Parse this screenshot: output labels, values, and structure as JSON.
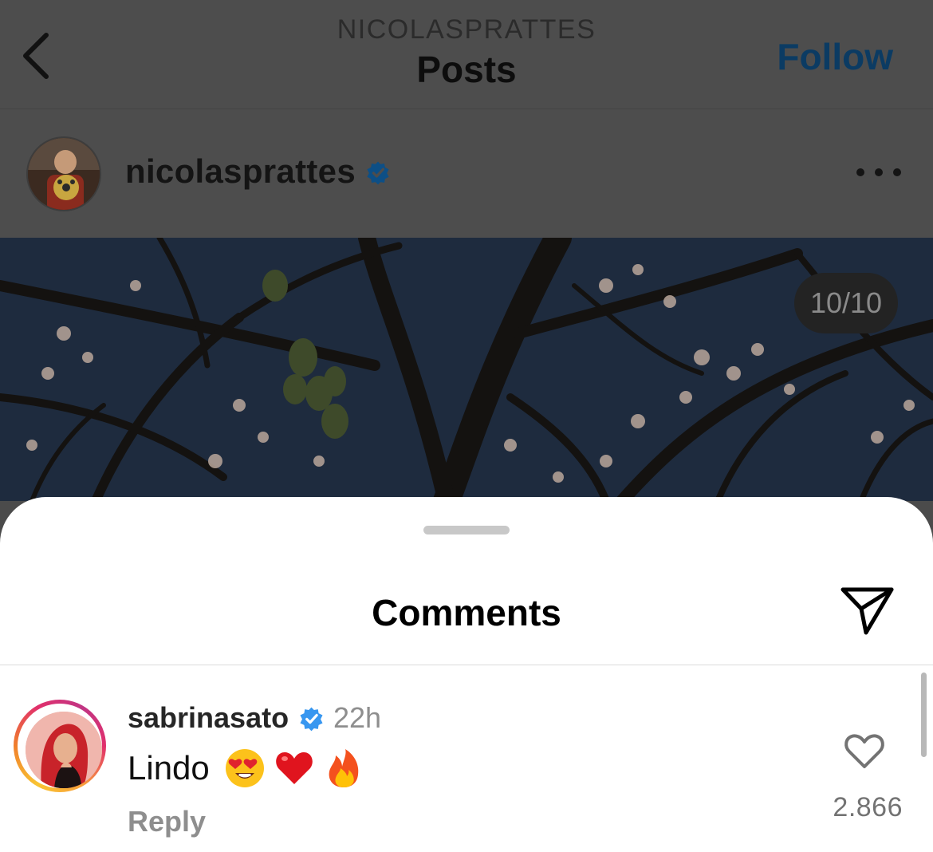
{
  "nav": {
    "subtitle": "NICOLASPRATTES",
    "title": "Posts",
    "follow_label": "Follow",
    "back_icon": "chevron-left-icon"
  },
  "post": {
    "username": "nicolasprattes",
    "verified": true,
    "more_icon": "more-horizontal-icon",
    "image_counter": "10/10"
  },
  "comments_sheet": {
    "title": "Comments",
    "share_icon": "paper-plane-icon"
  },
  "comments": [
    {
      "username": "sabrinasato",
      "verified": true,
      "time": "22h",
      "text": "Lindo",
      "emojis": [
        "heart-eyes-emoji",
        "red-heart-emoji",
        "fire-emoji"
      ],
      "reply_label": "Reply",
      "like_count": "2.866",
      "like_icon": "heart-outline-icon"
    }
  ],
  "colors": {
    "follow_blue": "#0b3b63",
    "verified_blue": "#3897f0",
    "overlay_bg": "#4d4d4d",
    "sheet_bg": "#ffffff",
    "muted_text": "#8e8e8e"
  }
}
